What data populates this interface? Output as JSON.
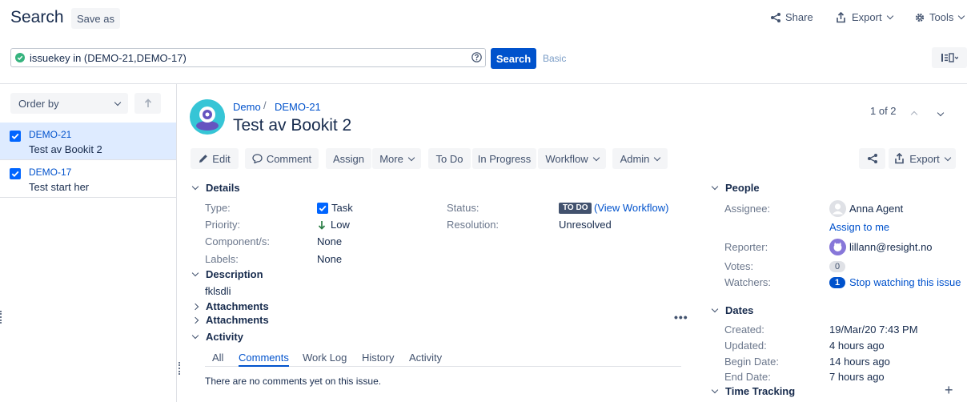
{
  "header": {
    "title": "Search",
    "save_as": "Save as",
    "share": "Share",
    "export": "Export",
    "tools": "Tools"
  },
  "search": {
    "query": "issuekey in (DEMO-21,DEMO-17)",
    "search_button": "Search",
    "basic_link": "Basic"
  },
  "sidebar": {
    "order_by": "Order by",
    "items": [
      {
        "key": "DEMO-21",
        "summary": "Test av Bookit 2"
      },
      {
        "key": "DEMO-17",
        "summary": "Test start her"
      }
    ]
  },
  "issue": {
    "project": "Demo",
    "key": "DEMO-21",
    "title": "Test av Bookit 2",
    "pager": "1 of 2"
  },
  "actions": {
    "edit": "Edit",
    "comment": "Comment",
    "assign": "Assign",
    "more": "More",
    "todo": "To Do",
    "in_progress": "In Progress",
    "workflow": "Workflow",
    "admin": "Admin",
    "export": "Export"
  },
  "details": {
    "heading": "Details",
    "type_label": "Type:",
    "type_value": "Task",
    "priority_label": "Priority:",
    "priority_value": "Low",
    "components_label": "Component/s:",
    "components_value": "None",
    "labels_label": "Labels:",
    "labels_value": "None",
    "status_label": "Status:",
    "status_badge": "TO DO",
    "view_workflow": "(View Workflow)",
    "resolution_label": "Resolution:",
    "resolution_value": "Unresolved"
  },
  "description": {
    "heading": "Description",
    "text": "fklsdli"
  },
  "attachments": [
    "Attachments",
    "Attachments"
  ],
  "activity": {
    "heading": "Activity",
    "tabs": [
      "All",
      "Comments",
      "Work Log",
      "History",
      "Activity"
    ],
    "active_tab": "Comments",
    "empty": "There are no comments yet on this issue."
  },
  "people": {
    "heading": "People",
    "assignee_label": "Assignee:",
    "assignee_value": "Anna Agent",
    "assign_to_me": "Assign to me",
    "reporter_label": "Reporter:",
    "reporter_value": "lillann@resight.no",
    "votes_label": "Votes:",
    "votes_value": "0",
    "watchers_label": "Watchers:",
    "watchers_count": "1",
    "stop_watching": "Stop watching this issue"
  },
  "dates": {
    "heading": "Dates",
    "created_label": "Created:",
    "created_value": "19/Mar/20 7:43 PM",
    "updated_label": "Updated:",
    "updated_value": "4 hours ago",
    "begin_label": "Begin Date:",
    "begin_value": "14 hours ago",
    "end_label": "End Date:",
    "end_value": "7 hours ago"
  },
  "time_tracking": {
    "heading": "Time Tracking"
  },
  "colors": {
    "primary": "#0052cc",
    "selected_row": "#deebff",
    "badge": "#42526e",
    "checkbox": "#0065ff"
  }
}
